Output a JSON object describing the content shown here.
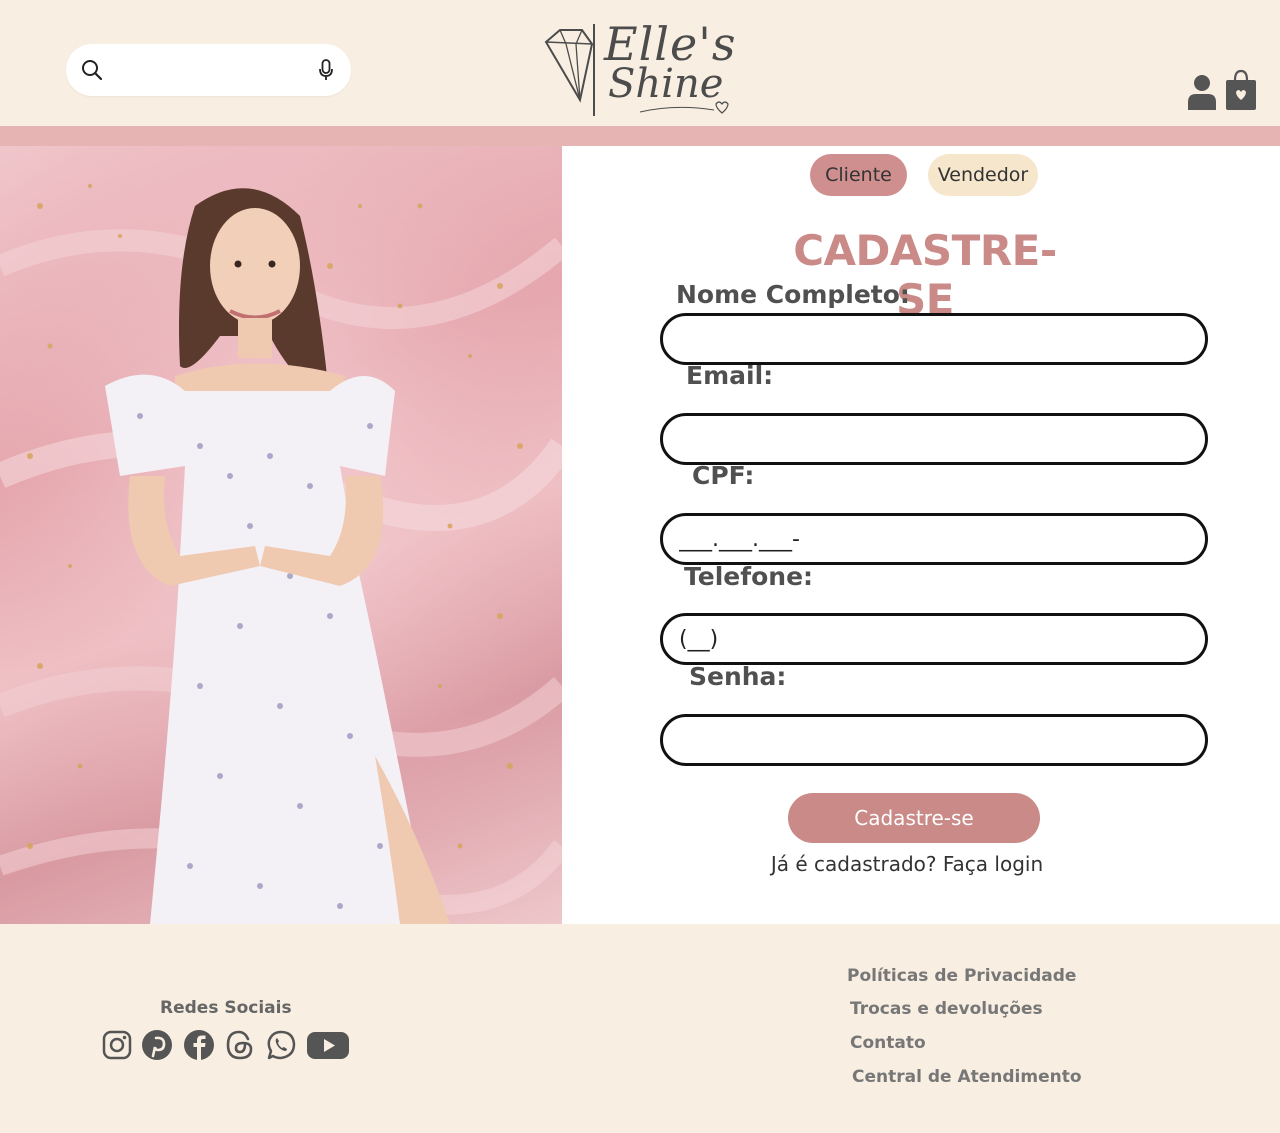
{
  "header": {
    "search": {
      "placeholder": ""
    },
    "logo": {
      "line1": "Elle's",
      "line2": "Shine"
    }
  },
  "form": {
    "tabs": [
      {
        "label": "Cliente",
        "active": true
      },
      {
        "label": "Vendedor",
        "active": false
      }
    ],
    "title": "CADASTRE-SE",
    "fields": {
      "nome": {
        "label": "Nome Completo:",
        "value": ""
      },
      "email": {
        "label": "Email:",
        "value": ""
      },
      "cpf": {
        "label": "CPF:",
        "value": "___.___.___-"
      },
      "telefone": {
        "label": "Telefone:",
        "value": "(__)"
      },
      "senha": {
        "label": "Senha:",
        "value": ""
      }
    },
    "submit_label": "Cadastre-se",
    "login_text": "Já é cadastrado? Faça login"
  },
  "footer": {
    "social_title": "Redes Sociais",
    "social_icons": [
      "instagram-icon",
      "pinterest-icon",
      "facebook-icon",
      "threads-icon",
      "whatsapp-icon",
      "youtube-icon"
    ],
    "links": [
      "Políticas de Privacidade",
      "Trocas e devoluções",
      "Contato",
      "Central de Atendimento"
    ]
  },
  "colors": {
    "background": "#f8efe2",
    "band": "#e6b4b3",
    "accent": "#c98a88",
    "tab_active": "#cf8f8f",
    "tab_inactive": "#f5e6cc",
    "icon": "#555555"
  }
}
